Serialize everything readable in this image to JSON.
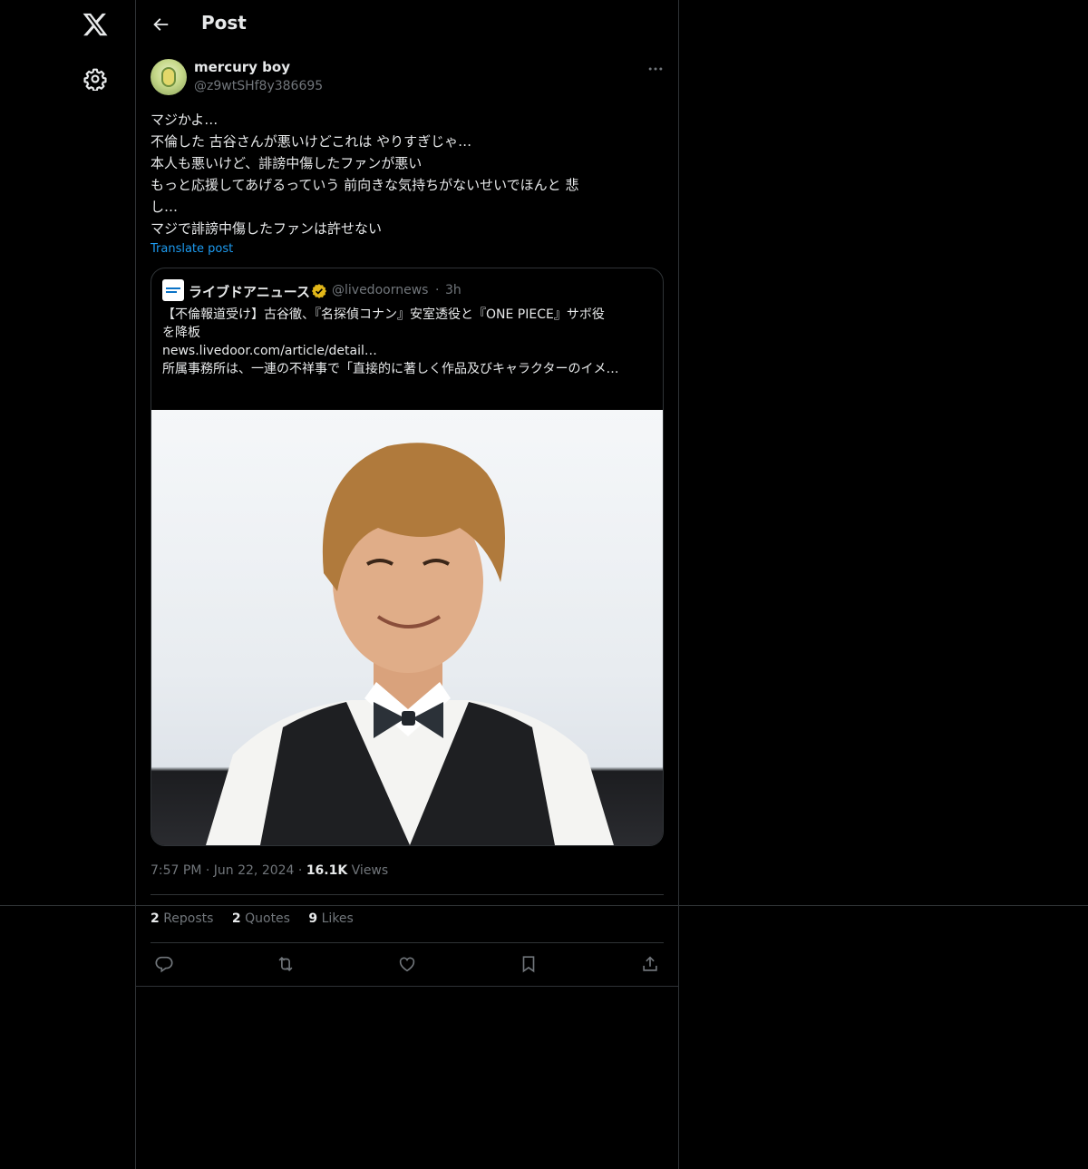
{
  "header": {
    "title": "Post"
  },
  "post": {
    "display_name": "mercury boy",
    "handle": "@z9wtSHf8y386695",
    "lines": [
      "マジかよ…",
      "不倫した 古谷さんが悪いけどこれは やりすぎじゃ…",
      "本人も悪いけど、誹謗中傷したファンが悪い",
      "もっと応援してあげるっていう 前向きな気持ちがないせいでほんと 悲",
      "し…",
      "マジで誹謗中傷したファンは許せない"
    ],
    "translate_label": "Translate post",
    "time": "7:57 PM",
    "date": "Jun 22, 2024",
    "views_count": "16.1K",
    "views_label": "Views",
    "stats": {
      "reposts_count": "2",
      "reposts_label": "Reposts",
      "quotes_count": "2",
      "quotes_label": "Quotes",
      "likes_count": "9",
      "likes_label": "Likes"
    }
  },
  "quote": {
    "display_name": "ライブドアニュース",
    "handle": "@livedoornews",
    "separator": "·",
    "time": "3h",
    "lines": [
      "【不倫報道受け】古谷徹、『名探偵コナン』安室透役と『ONE PIECE』サボ役",
      "を降板",
      "news.livedoor.com/article/detail…",
      " ",
      "所属事務所は、一連の不祥事で「直接的に著しく作品及びキャラクターのイメ…"
    ],
    "avatar_text": "News"
  },
  "colors": {
    "background": "#000000",
    "text": "#e7e9ea",
    "secondary": "#71767b",
    "link": "#1d9bf0",
    "border": "#2f3336",
    "verified": "#e2b719"
  },
  "icons": [
    "x-logo-icon",
    "gear-icon",
    "back-arrow-icon",
    "more-icon",
    "verified-badge-icon",
    "reply-icon",
    "repost-icon",
    "like-icon",
    "bookmark-icon",
    "share-icon"
  ]
}
